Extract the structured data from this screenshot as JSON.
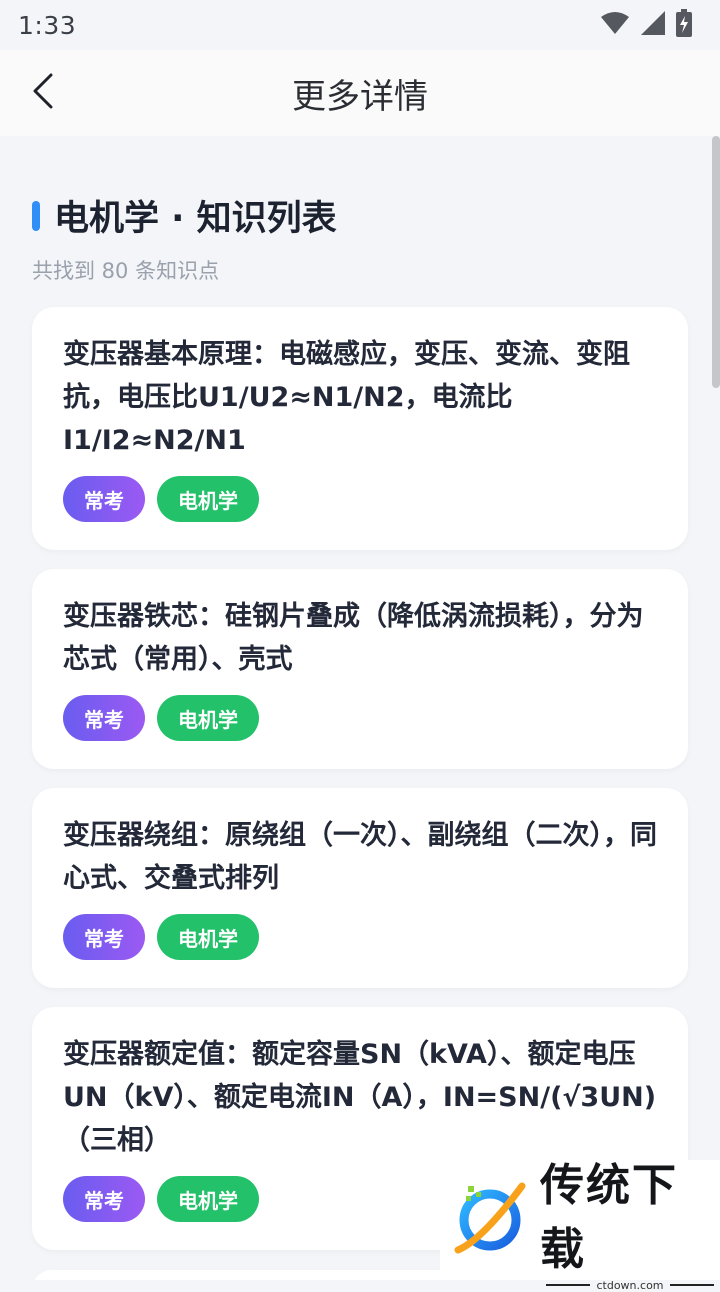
{
  "status_bar": {
    "time": "1:33"
  },
  "app_bar": {
    "title": "更多详情"
  },
  "section": {
    "title": "电机学 · 知识列表",
    "subtitle": "共找到 80 条知识点"
  },
  "cards": [
    {
      "text": "变压器基本原理：电磁感应，变压、变流、变阻抗，电压比U1/U2≈N1/N2，电流比I1/I2≈N2/N1",
      "tags": [
        "常考",
        "电机学"
      ]
    },
    {
      "text": "变压器铁芯：硅钢片叠成（降低涡流损耗），分为芯式（常用）、壳式",
      "tags": [
        "常考",
        "电机学"
      ]
    },
    {
      "text": "变压器绕组：原绕组（一次）、副绕组（二次），同心式、交叠式排列",
      "tags": [
        "常考",
        "电机学"
      ]
    },
    {
      "text": "变压器额定值：额定容量SN（kVA）、额定电压UN（kV）、额定电流IN（A），IN=SN/(√3UN)（三相）",
      "tags": [
        "常考",
        "电机学"
      ]
    }
  ],
  "watermark": {
    "text": "传统下载",
    "url": "ctdown.com"
  },
  "colors": {
    "accent": "#2f8ff7",
    "tag_purple": "#7b5cf1",
    "tag_green": "#22c16a"
  }
}
